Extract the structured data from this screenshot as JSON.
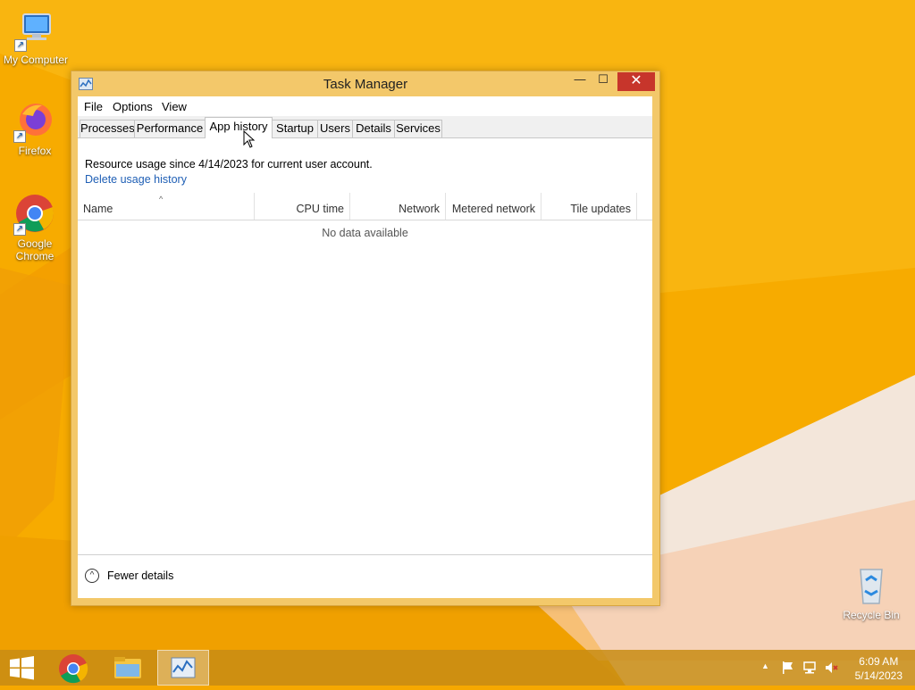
{
  "desktop": {
    "icons": [
      {
        "label": "My Computer"
      },
      {
        "label": "Firefox"
      },
      {
        "label": "Google Chrome"
      },
      {
        "label": "Recycle Bin"
      }
    ]
  },
  "window": {
    "title": "Task Manager",
    "close_glyph": "✕",
    "minimize_glyph": "—",
    "maximize_glyph": "☐"
  },
  "menu": [
    "File",
    "Options",
    "View"
  ],
  "tabs": [
    "Processes",
    "Performance",
    "App history",
    "Startup",
    "Users",
    "Details",
    "Services"
  ],
  "active_tab": "App history",
  "app_history": {
    "resource_text": "Resource usage since 4/14/2023 for current user account.",
    "delete_link": "Delete usage history",
    "columns": [
      "Name",
      "CPU time",
      "Network",
      "Metered network",
      "Tile updates"
    ],
    "sort_indicator": "^",
    "empty_text": "No data available"
  },
  "footer": {
    "label": "Fewer details",
    "icon_glyph": "^"
  },
  "taskbar": {
    "clock_time": "6:09 AM",
    "clock_date": "5/14/2023",
    "tray_glyph": "▲"
  },
  "colors": {
    "wallpaper": "#f6a800",
    "window_frame": "#f3c86a",
    "close_button": "#c7352b",
    "link": "#1f5fb5"
  }
}
